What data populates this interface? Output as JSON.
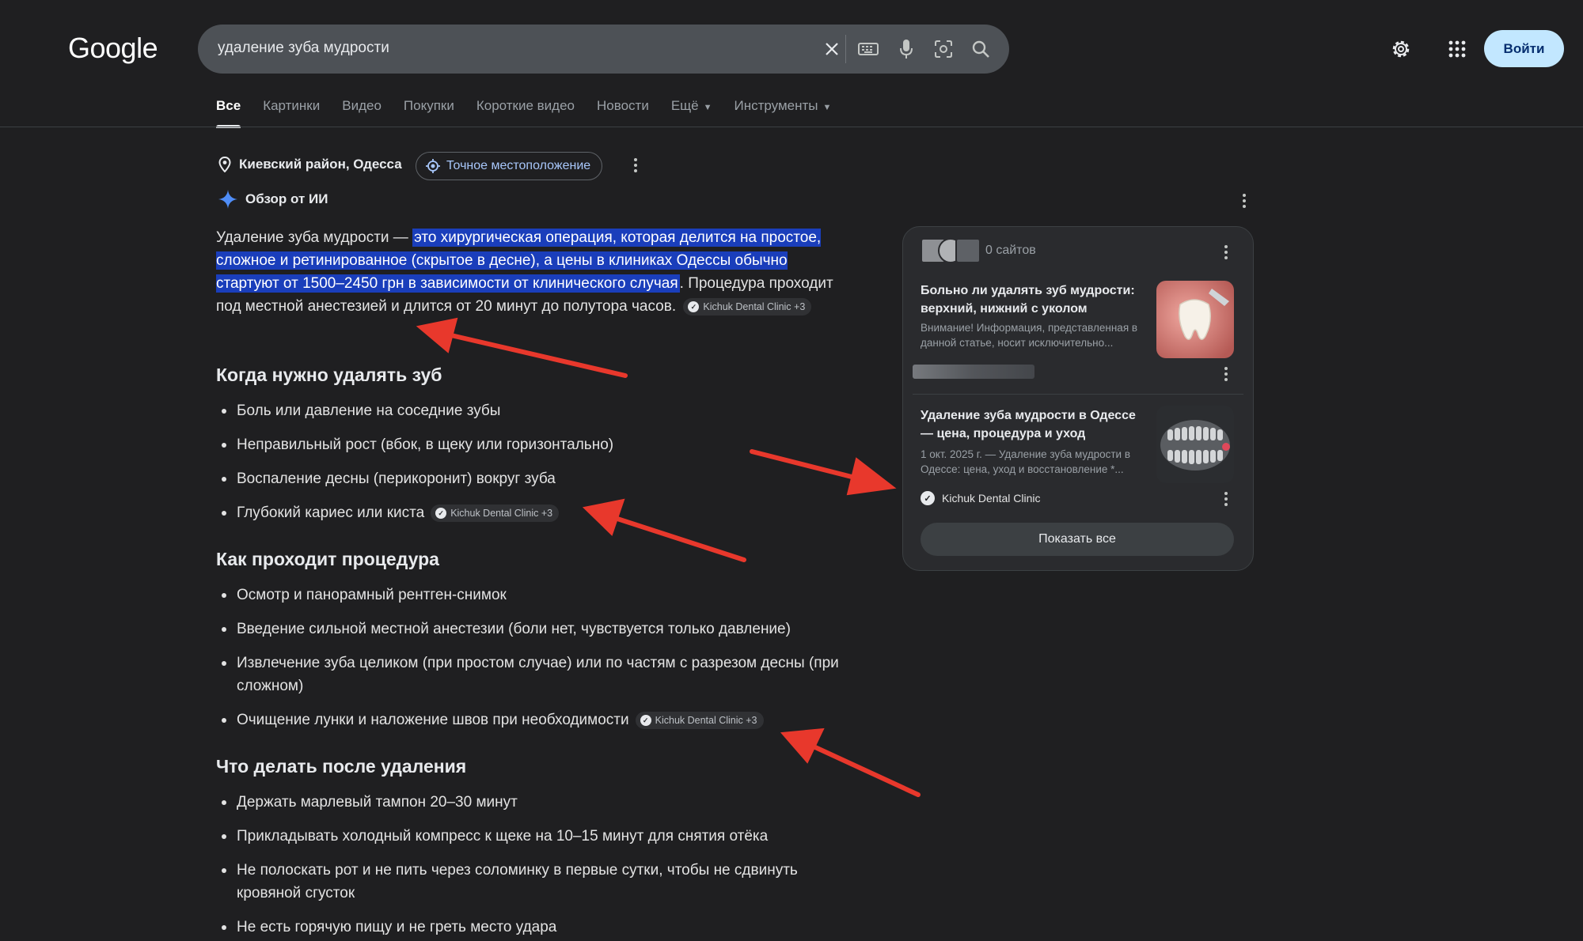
{
  "header": {
    "logo": "Google",
    "search_query": "удаление зуба мудрости",
    "login_label": "Войти"
  },
  "tabs": [
    {
      "label": "Все",
      "active": true
    },
    {
      "label": "Картинки"
    },
    {
      "label": "Видео"
    },
    {
      "label": "Покупки"
    },
    {
      "label": "Короткие видео"
    },
    {
      "label": "Новости"
    },
    {
      "label": "Ещё"
    },
    {
      "label": "Инструменты"
    }
  ],
  "location": {
    "name": "Киевский район, Одесса",
    "precise_label": "Точное местоположение"
  },
  "ai_overview": {
    "heading": "Обзор от ИИ",
    "intro_plain": "Удаление зуба мудрости — ",
    "intro_highlight": "это хирургическая операция, которая делится на простое, сложное и ретинированное (скрытое в десне), а цены в клиниках Одессы обычно стартуют от 1500–2450 грн в зависимости от клинического случая",
    "intro_end": ".",
    "intro_rest": " Процедура проходит под местной анестезией и длится от 20 минут до полутора часов.",
    "citation": "Kichuk Dental Clinic +3",
    "sections": [
      {
        "title": "Когда нужно удалять зуб",
        "items": [
          "Боль или давление на соседние зубы",
          "Неправильный рост (вбок, в щеку или горизонтально)",
          "Воспаление десны (перикоронит) вокруг зуба",
          "Глубокий кариес или киста"
        ]
      },
      {
        "title": "Как проходит процедура",
        "items": [
          "Осмотр и панорамный рентген-снимок",
          "Введение сильной местной анестезии (боли нет, чувствуется только давление)",
          "Извлечение зуба целиком (при простом случае) или по частям с разрезом десны (при сложном)",
          "Очищение лунки и наложение швов при необходимости"
        ]
      },
      {
        "title": "Что делать после удаления",
        "items": [
          "Держать марлевый тампон 20–30 минут",
          "Прикладывать холодный компресс к щеке на 10–15 минут для снятия отёка",
          "Не полоскать рот и не пить через соломинку в первые сутки, чтобы не сдвинуть кровяной сгусток",
          "Не есть горячую пищу и не греть место удара"
        ]
      }
    ]
  },
  "side_panel": {
    "sites_count": "0 сайтов",
    "cards": [
      {
        "title": "Больно ли удалять зуб мудрости: верхний, нижний с уколом",
        "snippet": "Внимание! Информация, представленная в данной статье, носит исключительно..."
      },
      {
        "title": "Удаление зуба мудрости в Одессе — цена, процедура и уход",
        "snippet": "1 окт. 2025 г. — Удаление зуба мудрости в Одессе: цена, уход и восстановление *...",
        "source": "Kichuk Dental Clinic"
      }
    ],
    "show_all_label": "Показать все"
  },
  "colors": {
    "background": "#1f1f21",
    "highlight": "#1a3ebb",
    "annotation_arrow": "#e8382c",
    "login_button": "#c2e7ff"
  }
}
